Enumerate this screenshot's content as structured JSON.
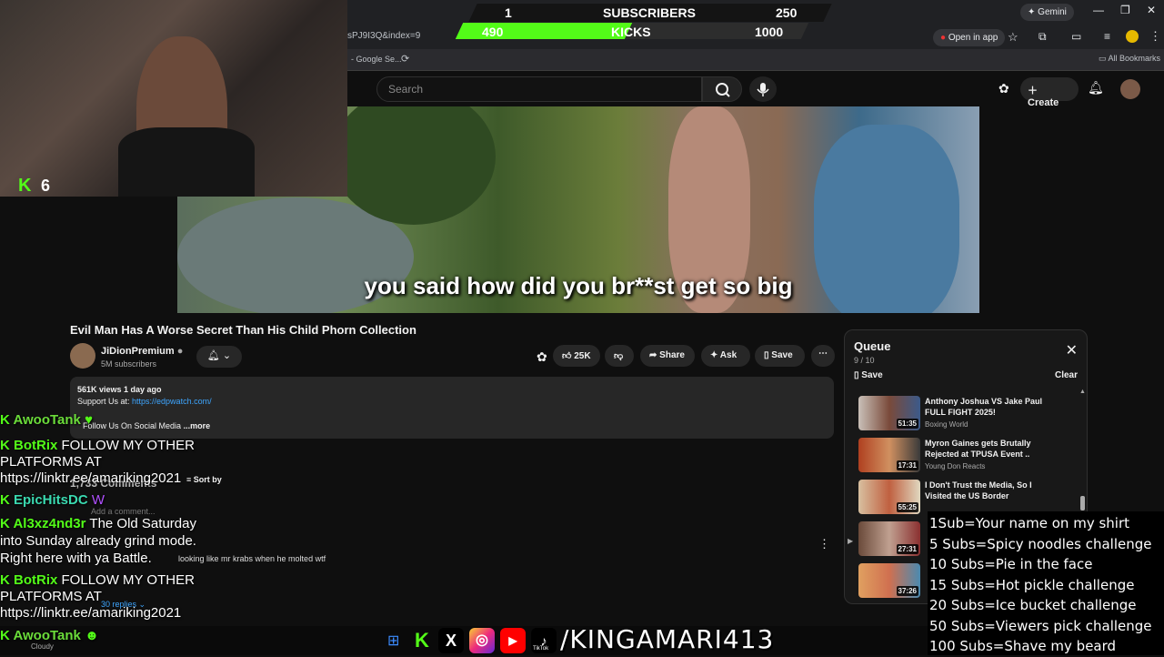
{
  "goal_overlay": {
    "subs_current": "1",
    "subs_label": "SUBSCRIBERS",
    "subs_target": "250",
    "kicks_current": "490",
    "kicks_label": "KICKS",
    "kicks_target": "1000",
    "kicks_progress": 0.49
  },
  "browser": {
    "gemini_label": "Gemini",
    "url_fragment": "sPJ9I3Q&index=9",
    "bookmark_fragment": "- Google Se...",
    "open_in_app": "Open in app",
    "all_bookmarks": "All Bookmarks"
  },
  "webcam": {
    "viewer_count": "6"
  },
  "youtube": {
    "search_placeholder": "Search",
    "create_label": "Create",
    "subtitle": "you said how did you br**st get so big",
    "video_title": "Evil Man Has A Worse Secret Than His Child Phorn Collection",
    "channel_name": "JiDionPremium",
    "channel_subs": "5M subscribers",
    "likes": "25K",
    "share_label": "Share",
    "ask_label": "Ask",
    "save_label": "Save",
    "description": {
      "stats": "561K views  1 day ago",
      "support_prefix": "Support Us at: ",
      "support_link": "https://edpwatch.com/",
      "follow_text": "Follow Us On Social Media",
      "more": "...more"
    },
    "comments": {
      "count": "1,733 Comments",
      "sort": "Sort by",
      "add_placeholder": "Add a comment...",
      "comment_text": "looking like mr krabs when he molted wtf",
      "replies": "30 replies"
    }
  },
  "queue": {
    "title": "Queue",
    "position": "9 / 10",
    "save": "Save",
    "clear": "Clear",
    "items": [
      {
        "title": "Anthony Joshua VS Jake Paul FULL FIGHT 2025!",
        "channel": "Boxing World",
        "duration": "51:35"
      },
      {
        "title": "Myron Gaines gets Brutally Rejected at TPUSA Event ..",
        "channel": "Young Don Reacts",
        "duration": "17:31"
      },
      {
        "title": "I Don't Trust the Media, So I Visited the US Border",
        "channel": "",
        "duration": "55:25"
      },
      {
        "title": "",
        "channel": "",
        "duration": "27:31"
      },
      {
        "title": "",
        "channel": "",
        "duration": "37:26"
      }
    ]
  },
  "chat": [
    {
      "user": "AwooTank",
      "color": "#6bdc3a",
      "text": ""
    },
    {
      "user": "BotRix",
      "color": "#53fc18",
      "text": "FOLLOW MY OTHER"
    },
    {
      "user": "",
      "color": "",
      "text": "PLATFORMS AT"
    },
    {
      "user": "",
      "color": "",
      "text": "https://linktr.ee/amariking2021"
    },
    {
      "user": "EpicHitsDC",
      "color": "#3ad9b0",
      "text": ""
    },
    {
      "user": "Al3xz4nd3r",
      "color": "#53fc18",
      "text": "The Old Saturday"
    },
    {
      "user": "",
      "color": "",
      "text": "into Sunday already grind mode."
    },
    {
      "user": "",
      "color": "",
      "text": "Right here with ya Battle."
    },
    {
      "user": "BotRix",
      "color": "#53fc18",
      "text": "FOLLOW MY OTHER"
    },
    {
      "user": "",
      "color": "",
      "text": "PLATFORMS AT"
    },
    {
      "user": "",
      "color": "",
      "text": "https://linktr.ee/amariking2021"
    },
    {
      "user": "AwooTank",
      "color": "#6bdc3a",
      "text": ""
    }
  ],
  "weather": "Cloudy",
  "goals_list": [
    "1Sub=Your name on my shirt",
    "5 Subs=Spicy noodles challenge",
    "10 Subs=Pie in the face",
    "15 Subs=Hot pickle challenge",
    "20 Subs=Ice bucket challenge",
    "50 Subs=Viewers pick challenge",
    "100 Subs=Shave my beard"
  ],
  "social": {
    "handle": "/KINGAMARI413",
    "tiktok_label": "TikTok"
  }
}
